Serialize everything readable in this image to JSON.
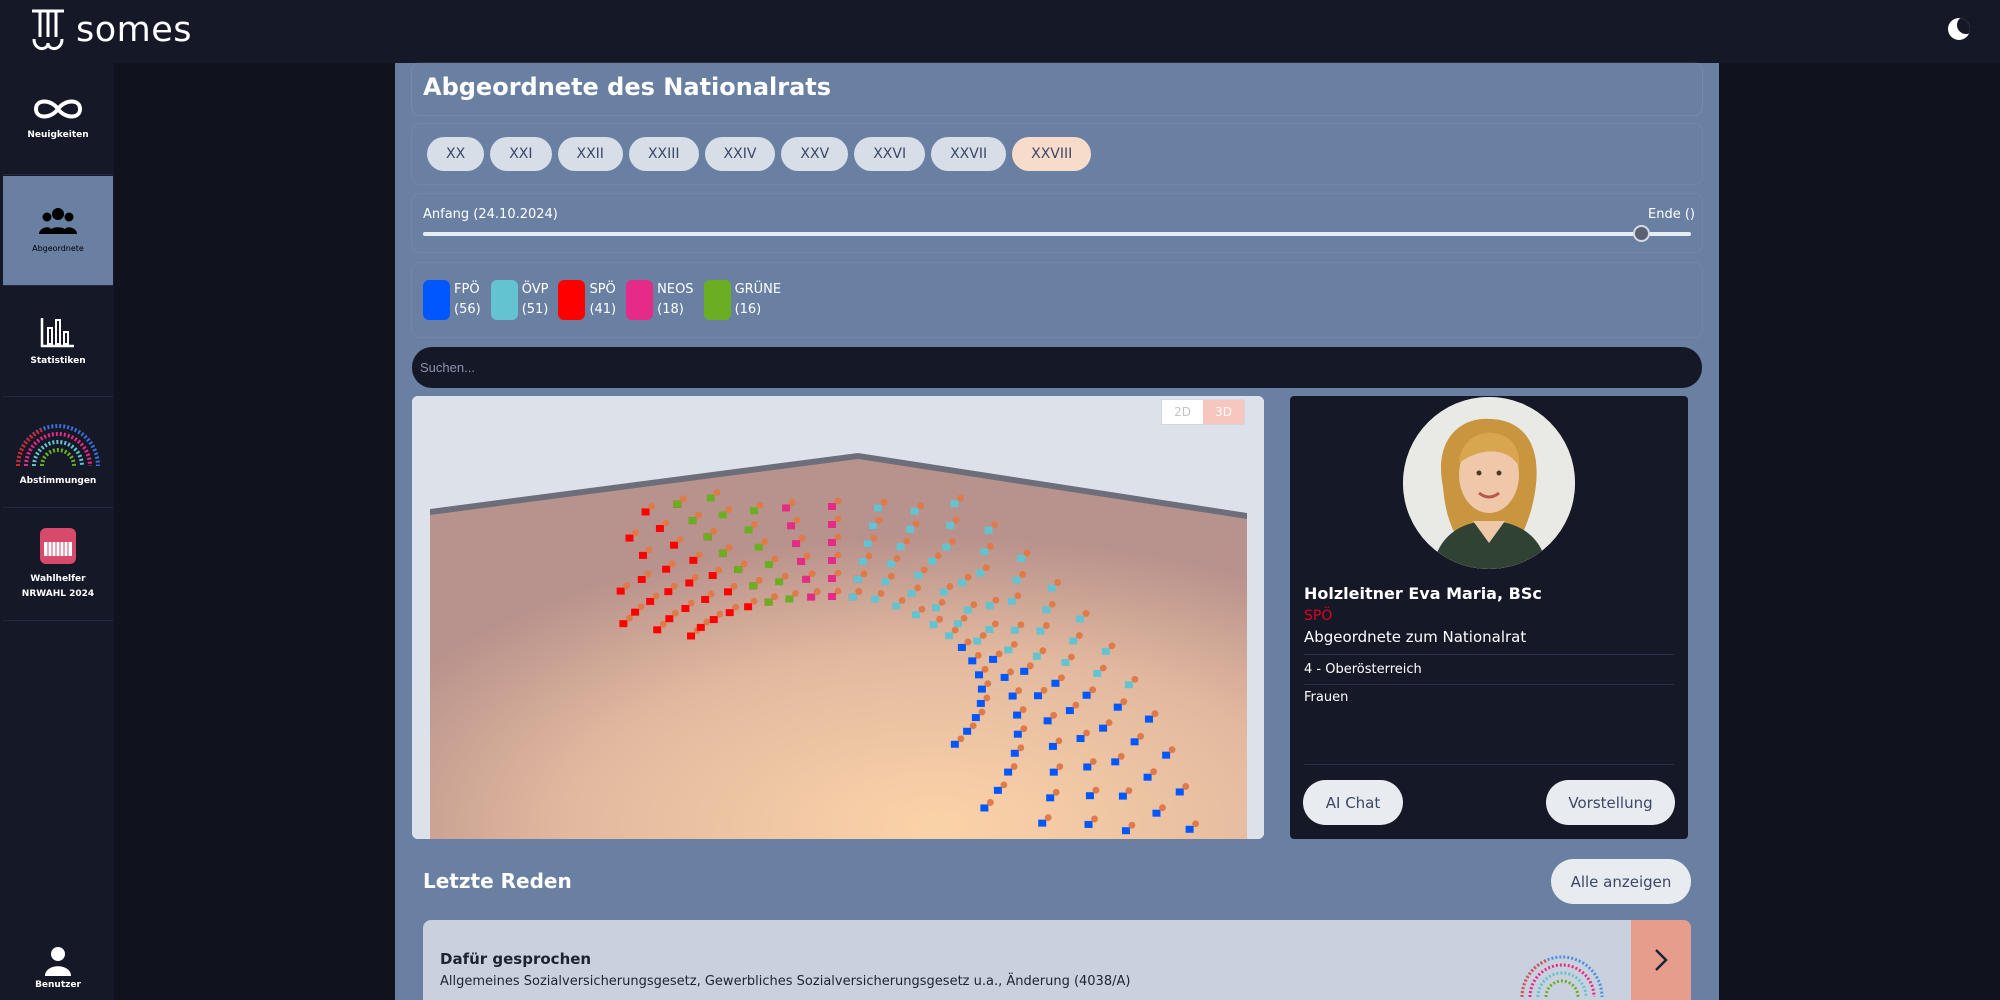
{
  "app": {
    "name": "somes"
  },
  "sidebar": {
    "items": [
      {
        "label": "Neuigkeiten",
        "icon": "infinity-icon"
      },
      {
        "label": "Abgeordnete",
        "icon": "people-icon"
      },
      {
        "label": "Statistiken",
        "icon": "bar-chart-icon"
      },
      {
        "label": "Abstimmungen",
        "icon": "parliament-icon"
      },
      {
        "label": "Wahlhelfer",
        "label2": "NRWAHL 2024",
        "icon": "ballot-icon"
      },
      {
        "label": "Benutzer",
        "icon": "user-icon"
      }
    ]
  },
  "page": {
    "title": "Abgeordnete des Nationalrats"
  },
  "periods": [
    "XX",
    "XXI",
    "XXII",
    "XXIII",
    "XXIV",
    "XXV",
    "XXVI",
    "XXVII",
    "XXVIII"
  ],
  "active_period": "XXVIII",
  "timeline": {
    "start_label": "Anfang (24.10.2024)",
    "end_label": "Ende ()",
    "position": 0.96
  },
  "parties": [
    {
      "name": "FPÖ",
      "count": "(56)",
      "color": "#0057ff"
    },
    {
      "name": "ÖVP",
      "count": "(51)",
      "color": "#63c3d0"
    },
    {
      "name": "SPÖ",
      "count": "(41)",
      "color": "#ff0000"
    },
    {
      "name": "NEOS",
      "count": "(18)",
      "color": "#e62a87"
    },
    {
      "name": "GRÜNE",
      "count": "(16)",
      "color": "#6aaf22"
    }
  ],
  "search": {
    "placeholder": "Suchen..."
  },
  "view_mode": {
    "options": [
      "2D",
      "3D"
    ],
    "active": "3D"
  },
  "profile": {
    "name": "Holzleitner Eva Maria, BSc",
    "party": "SPÖ",
    "role": "Abgeordnete zum Nationalrat",
    "district": "4 - Oberösterreich",
    "group": "Frauen",
    "ai_chat": "AI Chat",
    "intro": "Vorstellung"
  },
  "speeches": {
    "title": "Letzte Reden",
    "show_all": "Alle anzeigen",
    "items": [
      {
        "stance": "Dafür gesprochen",
        "topic": "Allgemeines Sozialversicherungsgesetz, Gewerbliches Sozialversicherungsgesetz u.a., Änderung (4038/A)"
      }
    ]
  }
}
